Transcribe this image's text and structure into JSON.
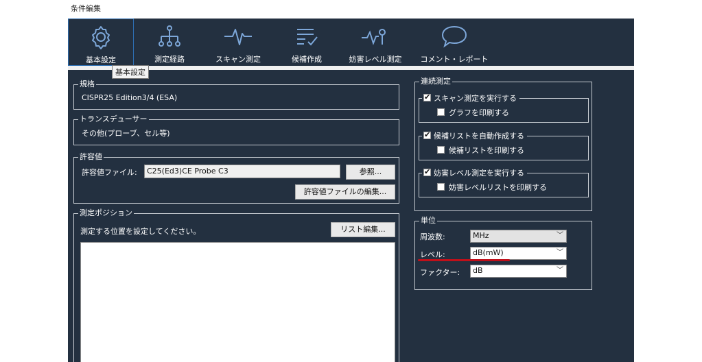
{
  "window_title": "条件編集",
  "toolbar": {
    "items": [
      {
        "label": "基本設定",
        "icon": "gear-icon",
        "active": true
      },
      {
        "label": "測定経路",
        "icon": "route-tree-icon"
      },
      {
        "label": "スキャン測定",
        "icon": "waveform-icon"
      },
      {
        "label": "候補作成",
        "icon": "checklist-icon"
      },
      {
        "label": "妨害レベル測定",
        "icon": "signal-probe-icon"
      },
      {
        "label": "コメント・レポート",
        "icon": "speech-bubble-icon"
      }
    ],
    "tooltip": "基本設定"
  },
  "standard": {
    "title": "規格",
    "value": "CISPR25 Edition3/4 (ESA)"
  },
  "transducer": {
    "title": "トランスデューサー",
    "value": "その他(プローブ、セル等)"
  },
  "limit": {
    "title": "許容値",
    "file_label": "許容値ファイル:",
    "file_value": "C25(Ed3)CE Probe C3",
    "browse_button": "参照...",
    "edit_button": "許容値ファイルの編集..."
  },
  "position": {
    "title": "測定ポジション",
    "instruction": "測定する位置を設定してください。",
    "list_edit_button": "リスト編集..."
  },
  "continuous": {
    "title": "連続測定",
    "groups": [
      {
        "label": "スキャン測定を実行する",
        "checked": true,
        "sub_label": "グラフを印刷する",
        "sub_checked": false
      },
      {
        "label": "候補リストを自動作成する",
        "checked": true,
        "sub_label": "候補リストを印刷する",
        "sub_checked": false
      },
      {
        "label": "妨害レベル測定を実行する",
        "checked": true,
        "sub_label": "妨害レベルリストを印刷する",
        "sub_checked": false
      }
    ]
  },
  "units": {
    "title": "単位",
    "frequency_label": "周波数:",
    "frequency_value": "MHz",
    "level_label": "レベル:",
    "level_value": "dB(mW)",
    "factor_label": "ファクター:",
    "factor_value": "dB"
  },
  "colors": {
    "background": "#233040",
    "accent": "#2d6fb4",
    "annotation": "#c0101a",
    "icon": "#7da7d9"
  }
}
